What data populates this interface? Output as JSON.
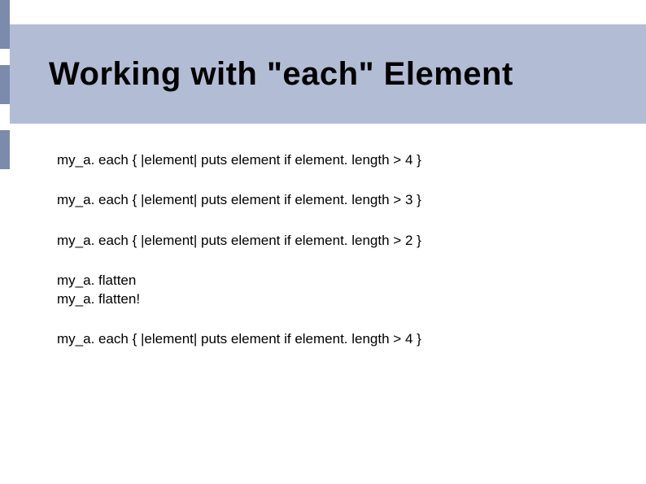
{
  "title": "Working with \"each\" Element",
  "code_lines": {
    "l1": "my_a. each { |element| puts element if element. length > 4 }",
    "l2": "my_a. each { |element| puts element if element. length > 3 }",
    "l3": "my_a. each { |element| puts element if element. length > 2 }",
    "l4a": "my_a. flatten",
    "l4b": "my_a. flatten!",
    "l5": "my_a. each { |element| puts element if element. length > 4 }"
  }
}
